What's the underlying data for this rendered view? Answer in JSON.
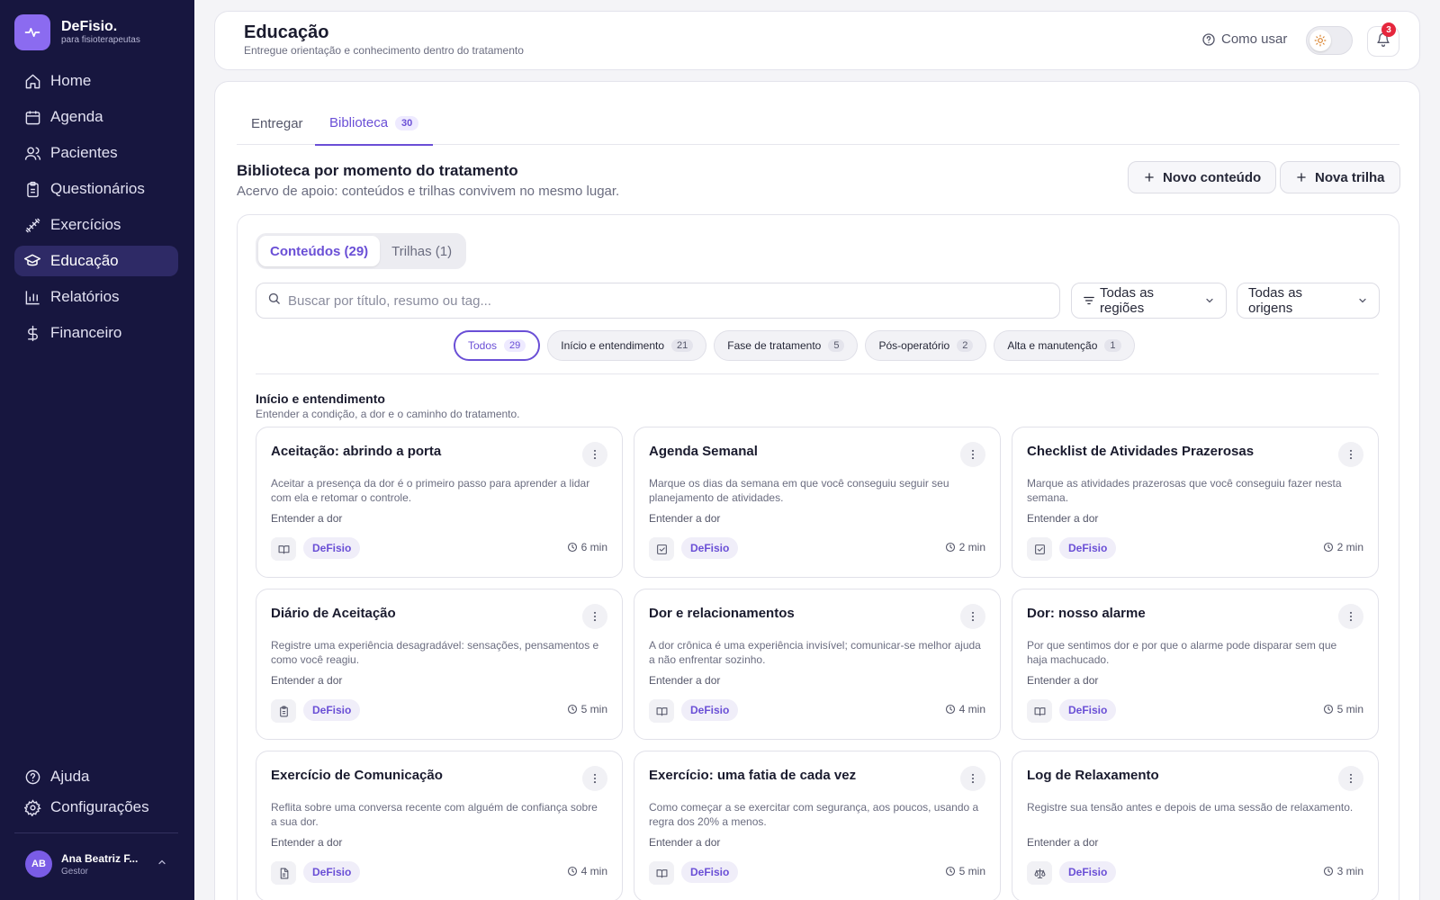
{
  "brand": {
    "name": "DeFisio.",
    "subtitle": "para fisioterapeutas",
    "color": "#8b6bf0"
  },
  "sidebar": {
    "items": [
      {
        "label": "Home",
        "icon": "home-icon"
      },
      {
        "label": "Agenda",
        "icon": "calendar-icon"
      },
      {
        "label": "Pacientes",
        "icon": "users-icon"
      },
      {
        "label": "Questionários",
        "icon": "clipboard-icon"
      },
      {
        "label": "Exercícios",
        "icon": "dumbbell-icon"
      },
      {
        "label": "Educação",
        "icon": "graduation-cap-icon",
        "active": true
      },
      {
        "label": "Relatórios",
        "icon": "bar-chart-icon"
      },
      {
        "label": "Financeiro",
        "icon": "dollar-icon"
      }
    ],
    "bottom": [
      {
        "label": "Ajuda",
        "icon": "help-circle-icon"
      },
      {
        "label": "Configurações",
        "icon": "gear-icon"
      }
    ],
    "user": {
      "initials": "AB",
      "name": "Ana Beatriz F...",
      "role": "Gestor"
    }
  },
  "header": {
    "title": "Educação",
    "subtitle": "Entregue orientação e conhecimento dentro do tratamento",
    "howto_label": "Como usar",
    "notifications": "3"
  },
  "tabs": [
    {
      "label": "Entregar"
    },
    {
      "label": "Biblioteca",
      "badge": "30",
      "active": true
    }
  ],
  "section": {
    "title": "Biblioteca por momento do tratamento",
    "subtitle": "Acervo de apoio: conteúdos e trilhas convivem no mesmo lugar.",
    "new_content_label": "Novo conteúdo",
    "new_track_label": "Nova trilha"
  },
  "segmented": [
    {
      "label": "Conteúdos (29)",
      "active": true
    },
    {
      "label": "Trilhas (1)"
    }
  ],
  "search": {
    "placeholder": "Buscar por título, resumo ou tag...",
    "value": ""
  },
  "filters": {
    "region": "Todas as regiões",
    "origin": "Todas as origens"
  },
  "chips": [
    {
      "label": "Todos",
      "count": "29",
      "active": true
    },
    {
      "label": "Início e entendimento",
      "count": "21"
    },
    {
      "label": "Fase de tratamento",
      "count": "5"
    },
    {
      "label": "Pós-operatório",
      "count": "2"
    },
    {
      "label": "Alta e manutenção",
      "count": "1"
    }
  ],
  "group": {
    "title": "Início e entendimento",
    "subtitle": "Entender a condição, a dor e o caminho do tratamento."
  },
  "cards": [
    {
      "title": "Aceitação: abrindo a porta",
      "desc": "Aceitar a presença da dor é o primeiro passo para aprender a lidar com ela e retomar o controle.",
      "tag": "Entender a dor",
      "type_icon": "book-open-icon",
      "origin": "DeFisio",
      "time": "6 min"
    },
    {
      "title": "Agenda Semanal",
      "desc": "Marque os dias da semana em que você conseguiu seguir seu planejamento de atividades.",
      "tag": "Entender a dor",
      "type_icon": "check-square-icon",
      "origin": "DeFisio",
      "time": "2 min"
    },
    {
      "title": "Checklist de Atividades Prazerosas",
      "desc": "Marque as atividades prazerosas que você conseguiu fazer nesta semana.",
      "tag": "Entender a dor",
      "type_icon": "check-square-icon",
      "origin": "DeFisio",
      "time": "2 min"
    },
    {
      "title": "Diário de Aceitação",
      "desc": "Registre uma experiência desagradável: sensações, pensamentos e como você reagiu.",
      "tag": "Entender a dor",
      "type_icon": "clipboard-icon",
      "origin": "DeFisio",
      "time": "5 min"
    },
    {
      "title": "Dor e relacionamentos",
      "desc": "A dor crônica é uma experiência invisível; comunicar-se melhor ajuda a não enfrentar sozinho.",
      "tag": "Entender a dor",
      "type_icon": "book-open-icon",
      "origin": "DeFisio",
      "time": "4 min"
    },
    {
      "title": "Dor: nosso alarme",
      "desc": "Por que sentimos dor e por que o alarme pode disparar sem que haja machucado.",
      "tag": "Entender a dor",
      "type_icon": "book-open-icon",
      "origin": "DeFisio",
      "time": "5 min"
    },
    {
      "title": "Exercício de Comunicação",
      "desc": "Reflita sobre uma conversa recente com alguém de confiança sobre a sua dor.",
      "tag": "Entender a dor",
      "type_icon": "file-icon",
      "origin": "DeFisio",
      "time": "4 min"
    },
    {
      "title": "Exercício: uma fatia de cada vez",
      "desc": "Como começar a se exercitar com segurança, aos poucos, usando a regra dos 20% a menos.",
      "tag": "Entender a dor",
      "type_icon": "book-open-icon",
      "origin": "DeFisio",
      "time": "5 min"
    },
    {
      "title": "Log de Relaxamento",
      "desc": "Registre sua tensão antes e depois de uma sessão de relaxamento.",
      "tag": "Entender a dor",
      "type_icon": "scale-icon",
      "origin": "DeFisio",
      "time": "3 min"
    }
  ],
  "colors": {
    "sidebar_bg": "#17163f",
    "accent": "#6a4fd6",
    "badge_red": "#e5273d"
  }
}
